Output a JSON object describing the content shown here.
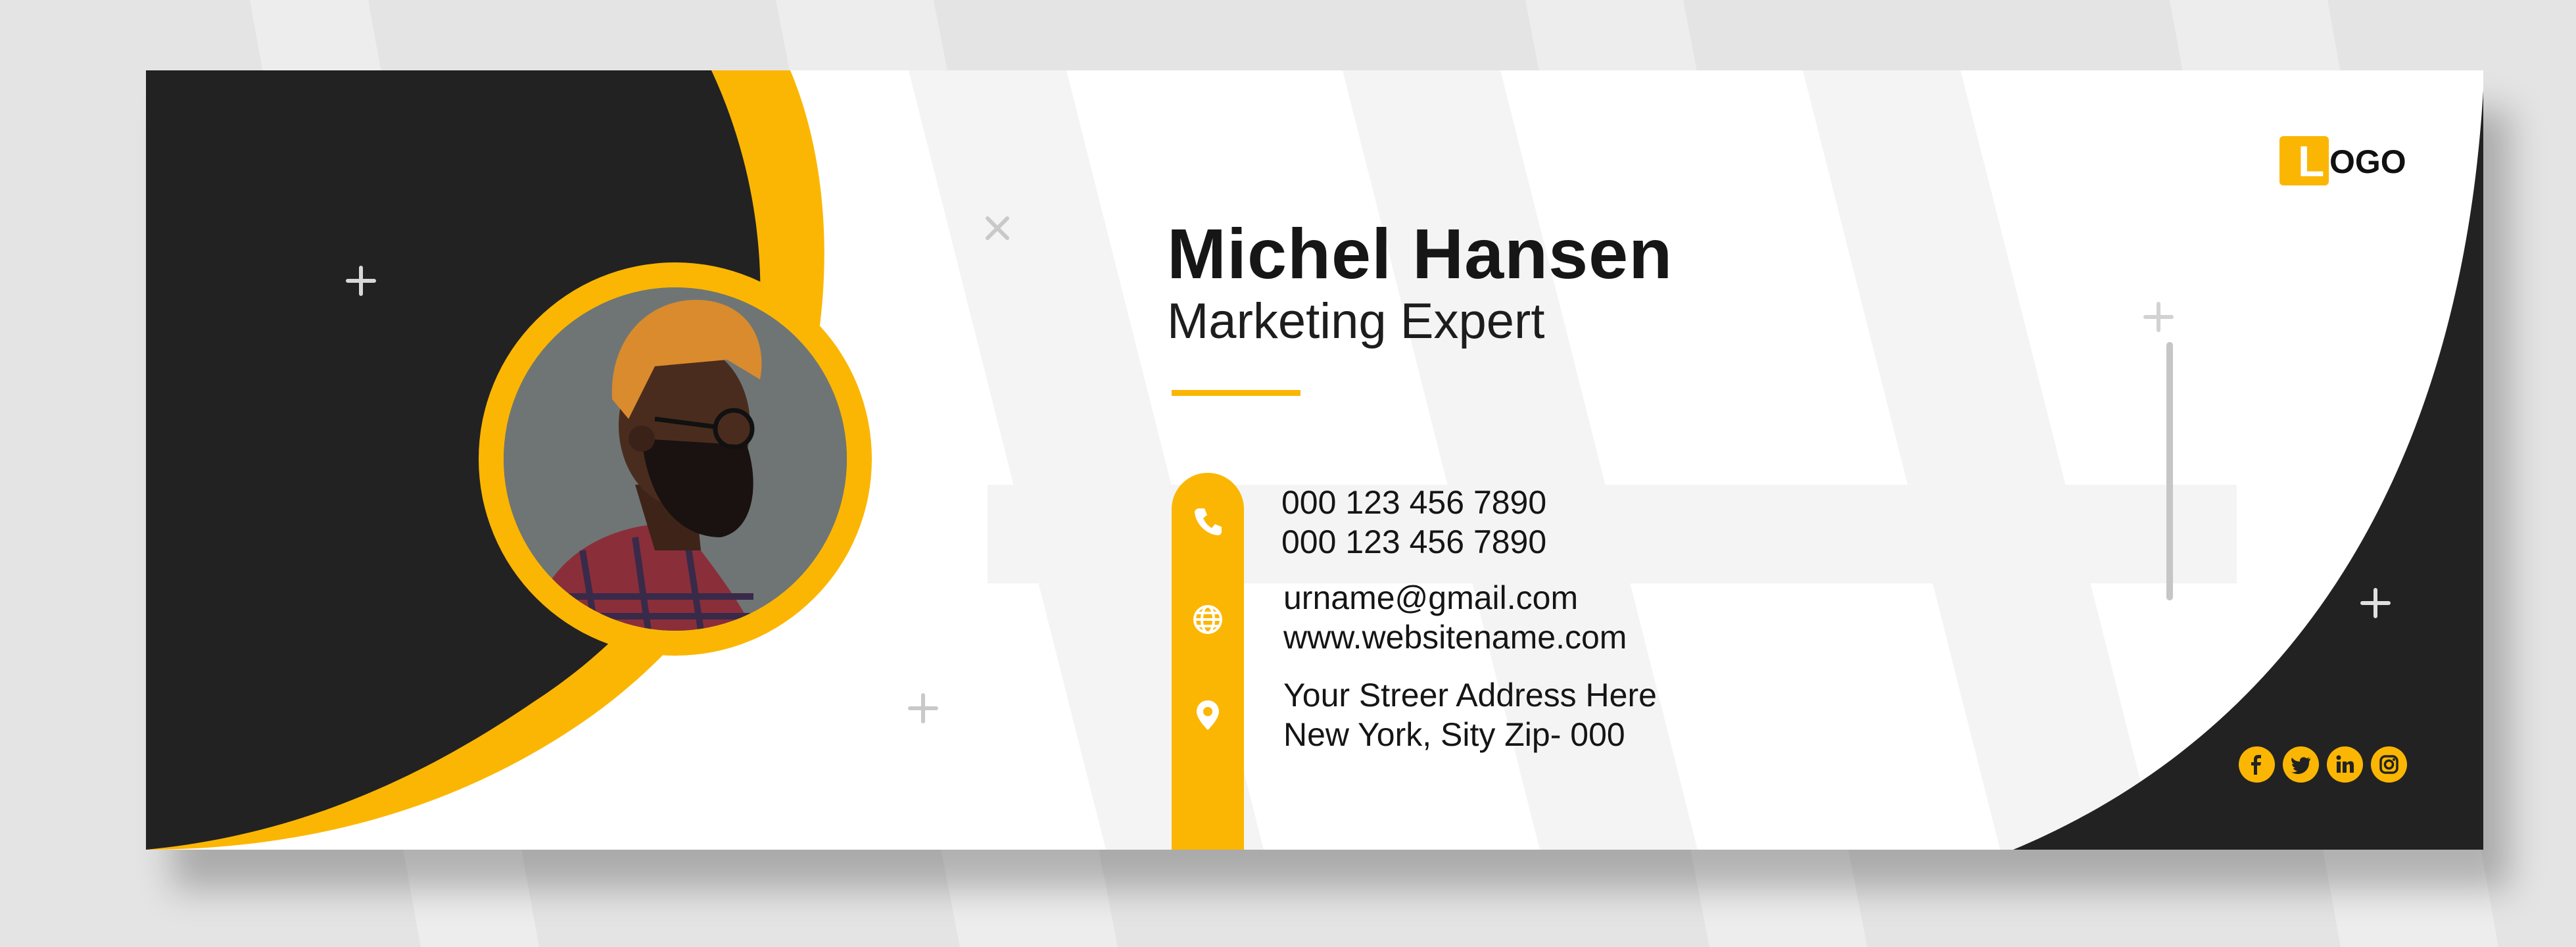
{
  "colors": {
    "accent": "#fbb603",
    "dark": "#222222",
    "background": "#e4e4e4",
    "card": "#ffffff"
  },
  "profile": {
    "name": "Michel Hansen",
    "title": "Marketing Expert",
    "photo_icon": "person-portrait"
  },
  "contact": {
    "phone": {
      "icon": "phone-icon",
      "lines": [
        "000 123 456 7890",
        "000 123 456 7890"
      ]
    },
    "web": {
      "icon": "globe-icon",
      "lines": [
        "urname@gmail.com",
        "www.websitename.com"
      ]
    },
    "address": {
      "icon": "location-pin-icon",
      "lines": [
        "Your Streer Address Here",
        "New York, Sity Zip- 000"
      ]
    }
  },
  "logo": {
    "letter": "L",
    "rest": "OGO"
  },
  "social": [
    {
      "icon": "facebook-icon"
    },
    {
      "icon": "twitter-icon"
    },
    {
      "icon": "linkedin-icon"
    },
    {
      "icon": "instagram-icon"
    }
  ]
}
